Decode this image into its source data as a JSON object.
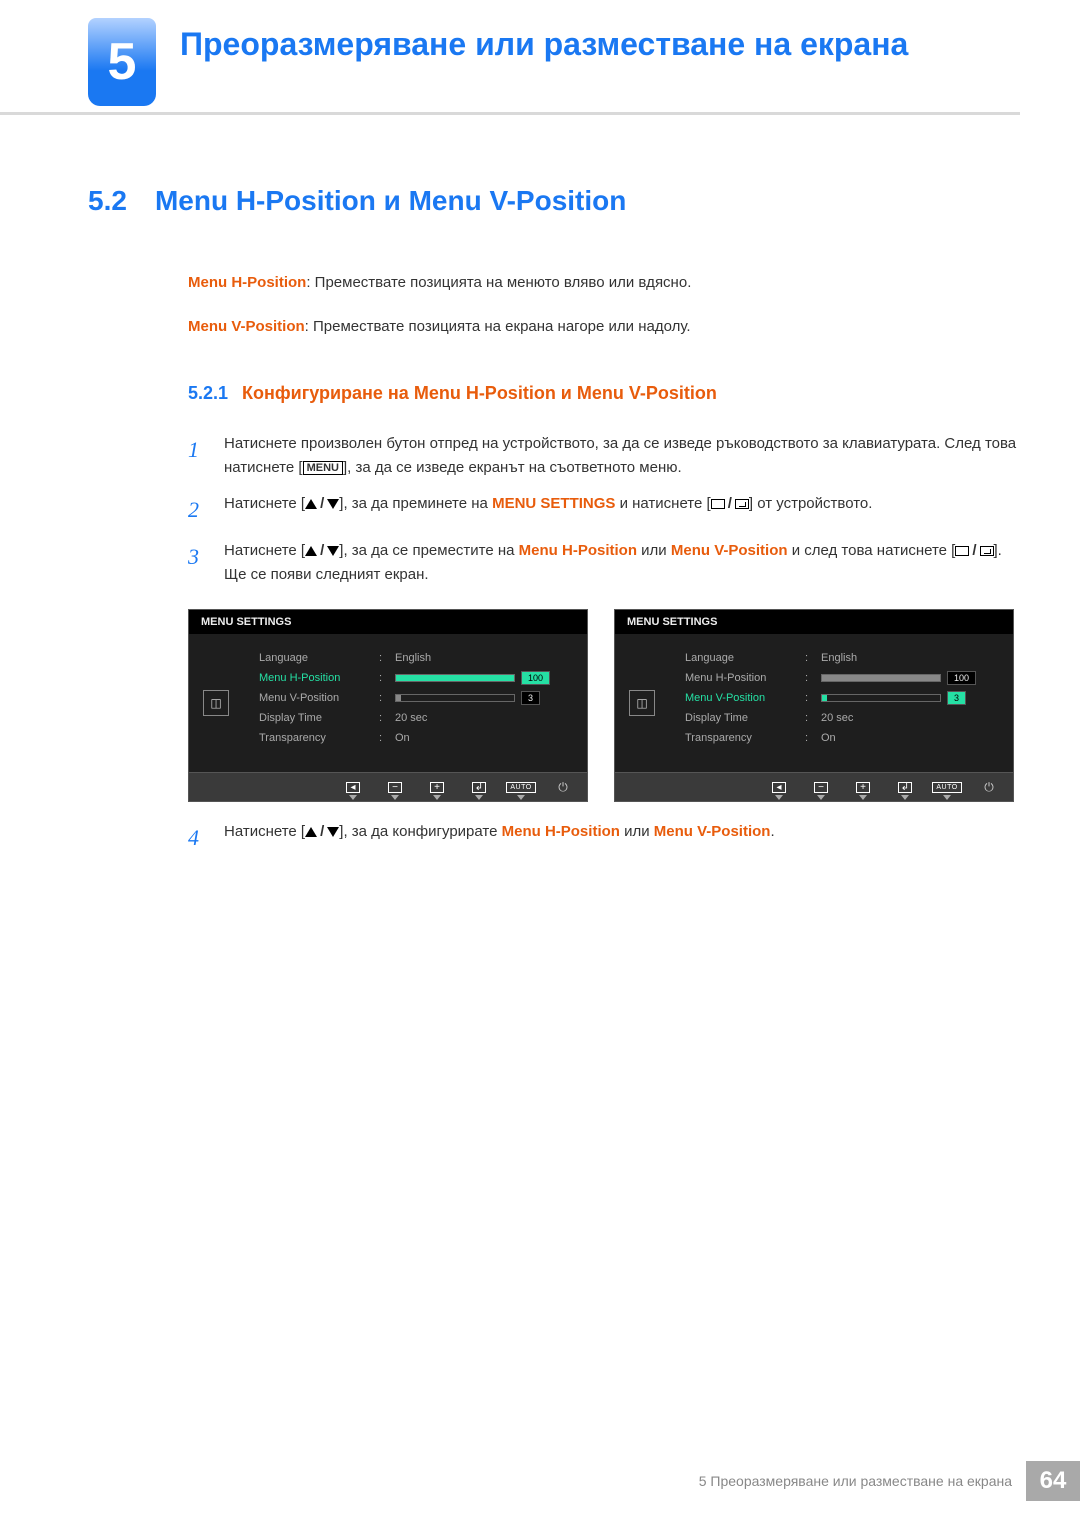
{
  "chapter": {
    "number": "5",
    "title": "Преоразмеряване или разместване на екрана"
  },
  "section": {
    "number": "5.2",
    "title": "Menu H-Position и Menu V-Position"
  },
  "definitions": {
    "h": {
      "term": "Menu H-Position",
      "text": ": Премествате позицията на менюто вляво или вдясно."
    },
    "v": {
      "term": "Menu V-Position",
      "text": ": Премествате позицията на екрана нагоре или надолу."
    }
  },
  "subsection": {
    "number": "5.2.1",
    "title": "Конфигуриране на Menu H-Position и Menu V-Position"
  },
  "steps": {
    "s1": {
      "num": "1",
      "a": "Натиснете произволен бутон отпред на устройството, за да се изведе ръководството за клавиатурата. След това натиснете [",
      "menu": "MENU",
      "b": "], за да се изведе екранът на съответното меню."
    },
    "s2": {
      "num": "2",
      "a": "Натиснете [",
      "b": "], за да преминете на ",
      "target": "MENU SETTINGS",
      "c": " и натиснете [",
      "d": "] от устройството."
    },
    "s3": {
      "num": "3",
      "a": "Натиснете [",
      "b": "], за да се преместите на ",
      "t1": "Menu H-Position",
      "mid": " или ",
      "t2": "Menu V-Position",
      "c": " и след това натиснете [",
      "d": "]. Ще се появи следният екран."
    },
    "s4": {
      "num": "4",
      "a": "Натиснете [",
      "b": "], за да конфигурирате ",
      "t1": "Menu H-Position",
      "mid": " или ",
      "t2": "Menu V-Position",
      "end": "."
    }
  },
  "osd": {
    "title": "MENU SETTINGS",
    "rows": {
      "language": {
        "label": "Language",
        "value": "English"
      },
      "hpos": {
        "label": "Menu H-Position",
        "value": "100",
        "fill": 100
      },
      "vpos": {
        "label": "Menu V-Position",
        "value": "3",
        "fill": 4
      },
      "dtime": {
        "label": "Display Time",
        "value": "20 sec"
      },
      "transp": {
        "label": "Transparency",
        "value": "On"
      }
    },
    "buttons": {
      "auto": "AUTO"
    }
  },
  "footer": {
    "text": "5 Преоразмеряване или разместване на екрана",
    "page": "64"
  }
}
